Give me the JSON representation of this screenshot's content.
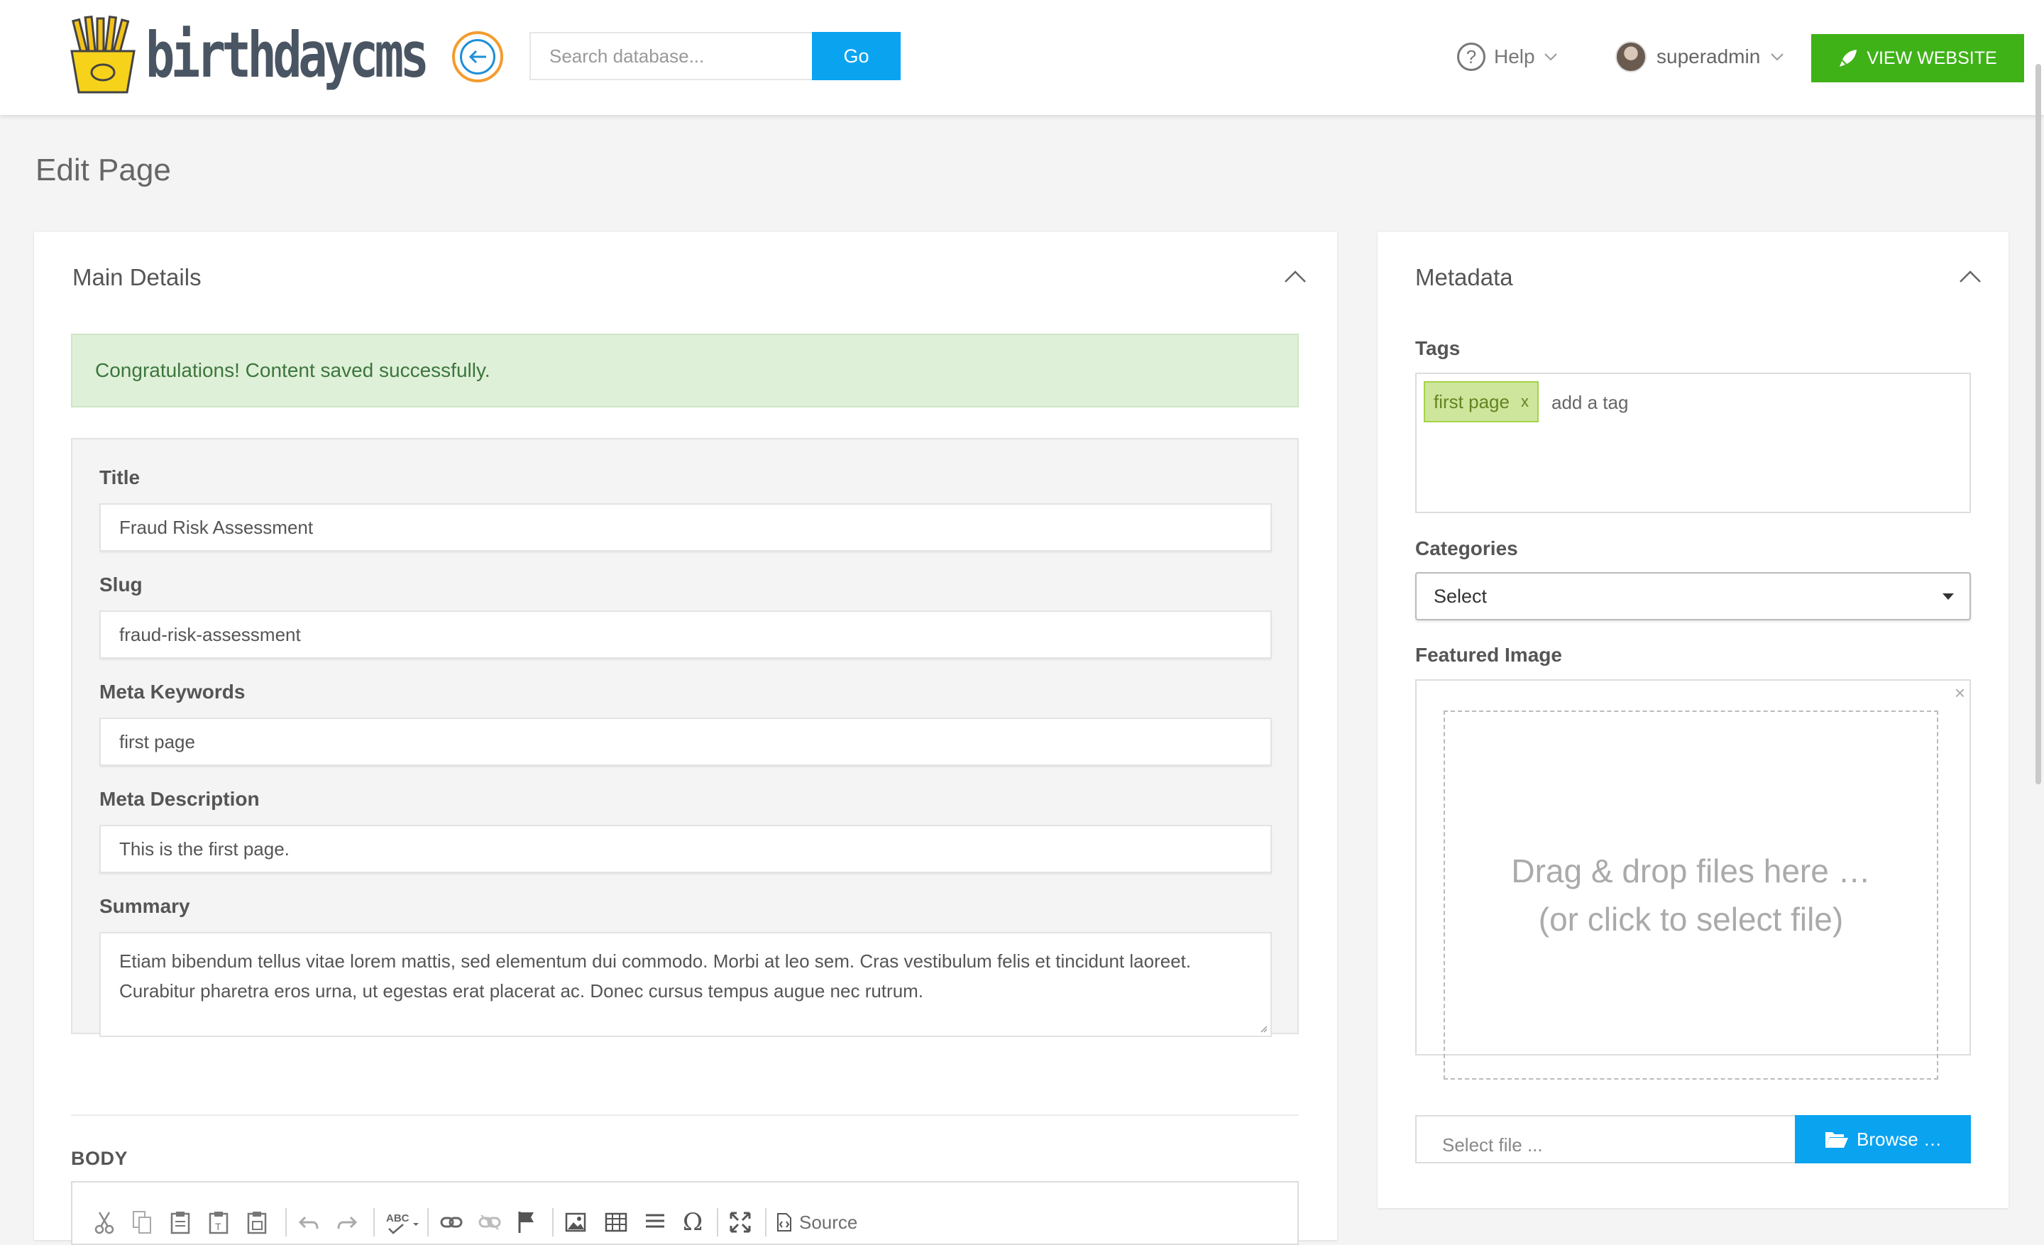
{
  "header": {
    "logo_text": "birthdaycms",
    "search_placeholder": "Search database...",
    "go_label": "Go",
    "help_label": "Help",
    "user_name": "superadmin",
    "view_website_label": "VIEW WEBSITE"
  },
  "page": {
    "title": "Edit Page"
  },
  "main_details": {
    "title": "Main Details",
    "alert": "Congratulations! Content saved successfully.",
    "fields": [
      {
        "label": "Title",
        "value": "Fraud Risk Assessment"
      },
      {
        "label": "Slug",
        "value": "fraud-risk-assessment"
      },
      {
        "label": "Meta Keywords",
        "value": "first page"
      },
      {
        "label": "Meta Description",
        "value": "This is the first page."
      }
    ],
    "summary_label": "Summary",
    "summary_value": "Etiam bibendum tellus vitae lorem mattis, sed elementum dui commodo. Morbi at leo sem. Cras vestibulum felis et tincidunt laoreet. Curabitur pharetra eros urna, ut egestas erat placerat ac. Donec cursus tempus augue nec rutrum.",
    "body_label": "BODY",
    "toolbar_source_label": "Source"
  },
  "metadata": {
    "title": "Metadata",
    "tags_label": "Tags",
    "tags": [
      "first page"
    ],
    "tag_remove": "x",
    "tag_input_placeholder": "add a tag",
    "categories_label": "Categories",
    "categories_selected": "Select",
    "featured_image_label": "Featured Image",
    "drop_line1": "Drag & drop files here …",
    "drop_line2": "(or click to select file)",
    "drop_close": "×",
    "file_placeholder": "Select file ...",
    "browse_label": "Browse …"
  },
  "colors": {
    "accent_blue": "#0aa3f0",
    "view_green": "#3fb218",
    "alert_bg": "#dff0d8",
    "tag_bg": "#cde69c"
  }
}
